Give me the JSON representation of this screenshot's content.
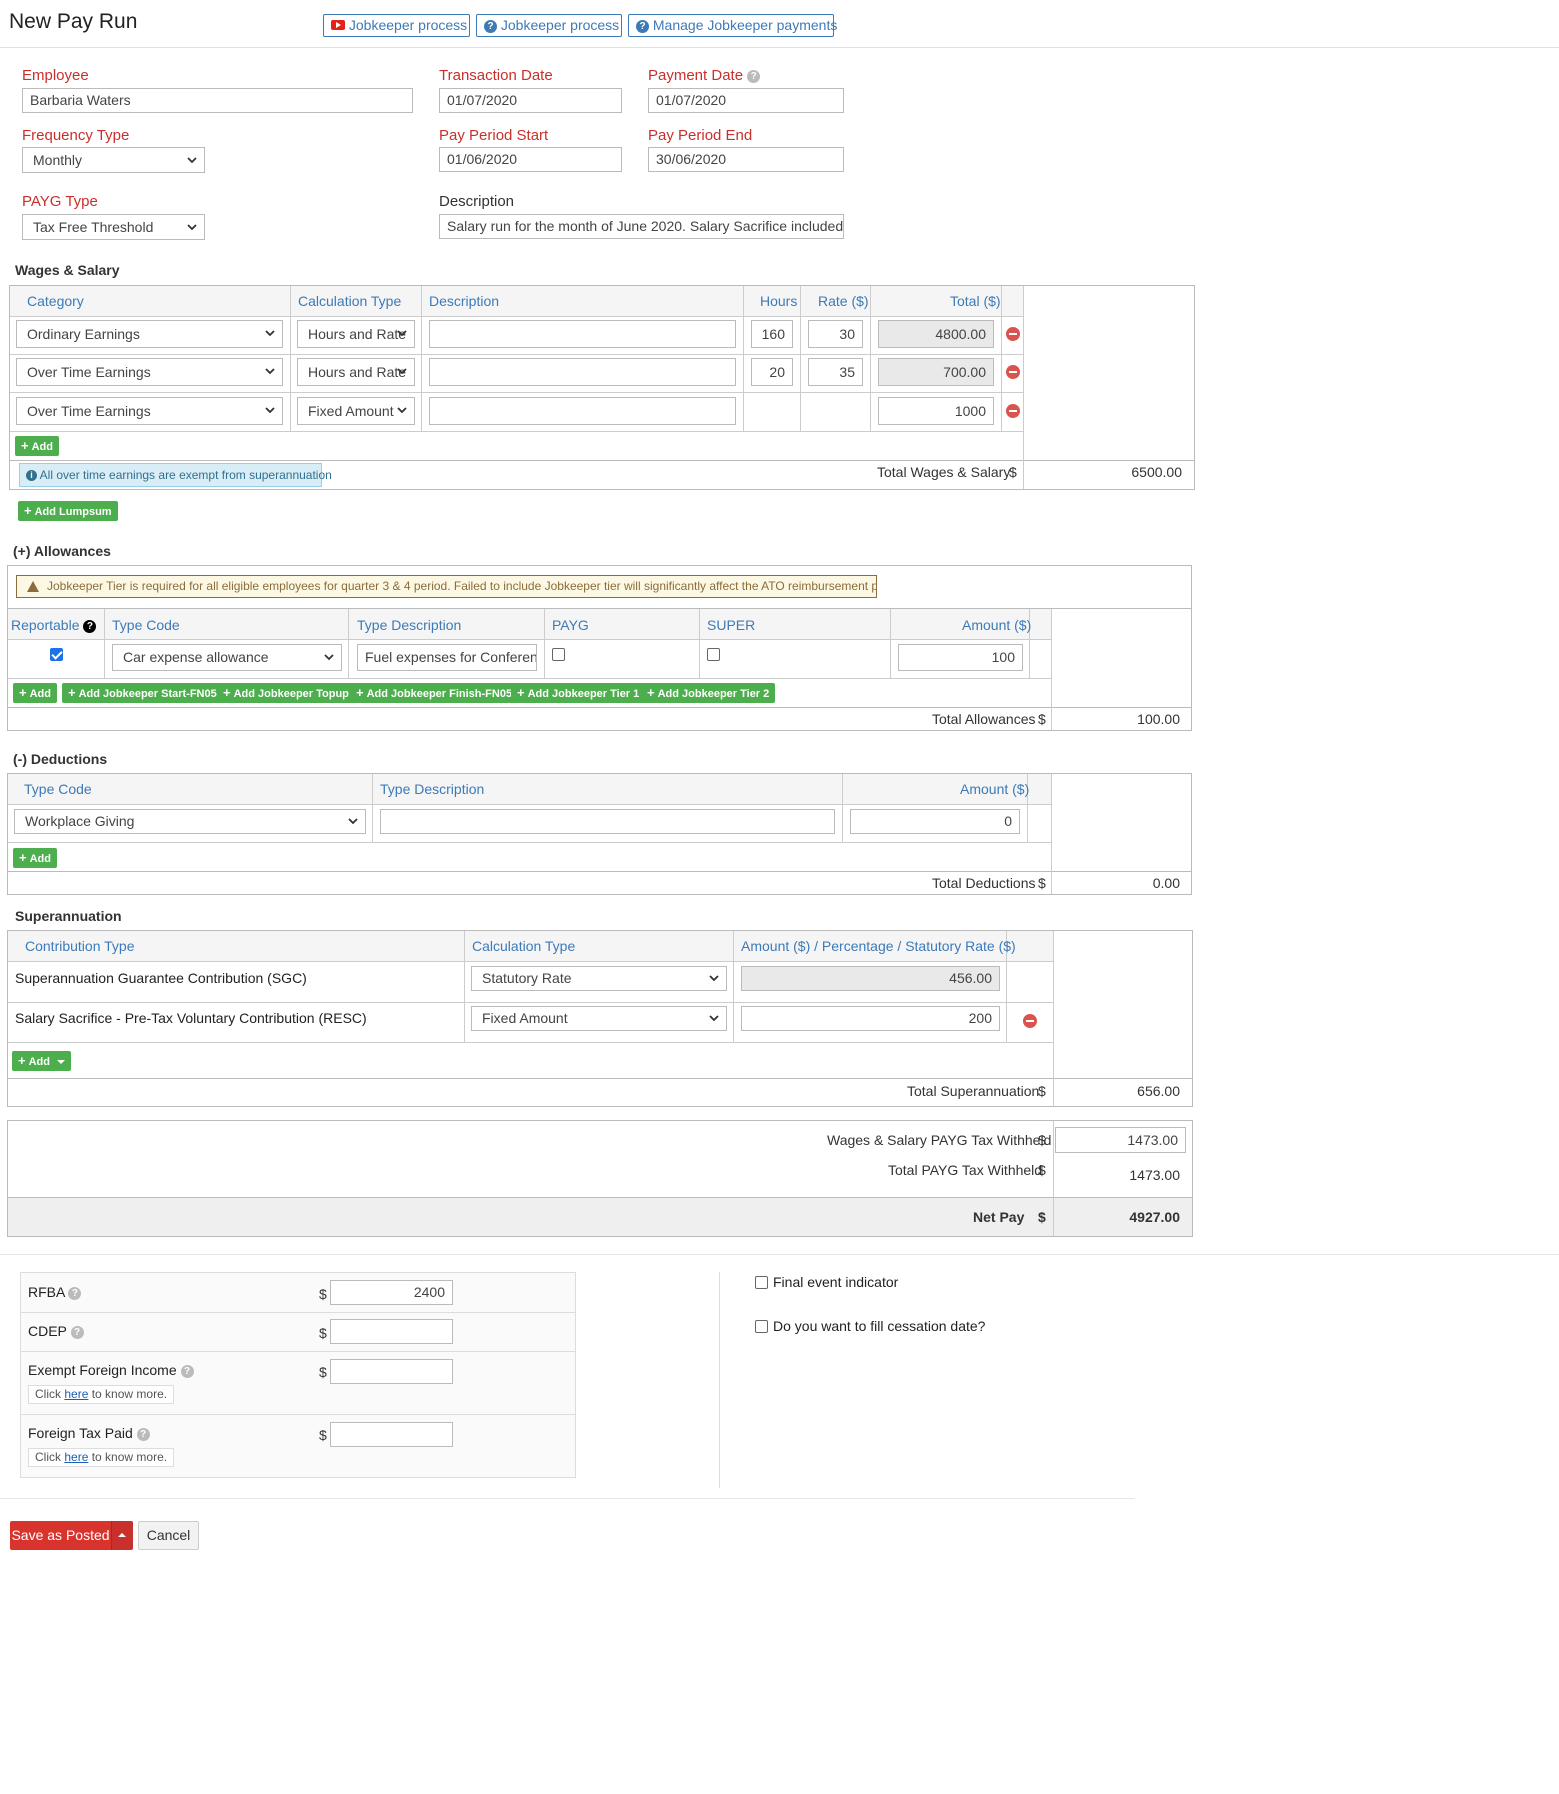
{
  "page_title": "New Pay Run",
  "top_buttons": [
    {
      "label": "Jobkeeper process",
      "icon": "youtube-icon"
    },
    {
      "label": "Jobkeeper process",
      "icon": "question-icon"
    },
    {
      "label": "Manage Jobkeeper payments",
      "icon": "question-icon"
    }
  ],
  "form": {
    "employee_label": "Employee",
    "employee_value": "Barbaria  Waters",
    "transaction_date_label": "Transaction Date",
    "transaction_date": "01/07/2020",
    "payment_date_label": "Payment Date",
    "payment_date": "01/07/2020",
    "frequency_label": "Frequency Type",
    "frequency_value": "Monthly",
    "pay_period_start_label": "Pay Period Start",
    "pay_period_start": "01/06/2020",
    "pay_period_end_label": "Pay Period End",
    "pay_period_end": "30/06/2020",
    "payg_type_label": "PAYG Type",
    "payg_type_value": "Tax Free Threshold",
    "description_label": "Description",
    "description_value": "Salary run for the month of June 2020. Salary Sacrifice included in RFBA"
  },
  "wages": {
    "title": "Wages & Salary",
    "headers": {
      "category": "Category",
      "calc": "Calculation Type",
      "desc": "Description",
      "hours": "Hours",
      "rate": "Rate ($)",
      "total": "Total ($)"
    },
    "rows": [
      {
        "category": "Ordinary Earnings",
        "calc": "Hours and Rate",
        "hours": "160",
        "rate": "30",
        "total": "4800.00"
      },
      {
        "category": "Over Time Earnings",
        "calc": "Hours and Rate",
        "hours": "20",
        "rate": "35",
        "total": "700.00"
      },
      {
        "category": "Over Time Earnings",
        "calc": "Fixed Amount",
        "hours": "",
        "rate": "",
        "total": "1000"
      }
    ],
    "add_label": "Add",
    "info_note": "All over time earnings are exempt from superannuation",
    "total_label": "Total Wages & Salary",
    "currency": "$",
    "total_value": "6500.00",
    "add_lumpsum_label": "Add Lumpsum"
  },
  "allowances": {
    "title": "(+) Allowances",
    "warning": "Jobkeeper Tier is required for all eligible employees for quarter 3 & 4 period. Failed to include Jobkeeper tier will significantly affect the ATO reimbursement process.",
    "headers": {
      "reportable": "Reportable",
      "type_code": "Type Code",
      "type_desc": "Type Description",
      "payg": "PAYG",
      "super": "SUPER",
      "amount": "Amount ($)"
    },
    "row": {
      "reportable": true,
      "type_code": "Car expense allowance",
      "type_desc": "Fuel expenses for Conference",
      "payg": false,
      "super": false,
      "amount": "100"
    },
    "buttons": [
      "Add",
      "Add Jobkeeper Start-FN05",
      "Add Jobkeeper Topup",
      "Add Jobkeeper Finish-FN05",
      "Add Jobkeeper Tier 1",
      "Add Jobkeeper Tier 2"
    ],
    "total_label": "Total Allowances",
    "currency": "$",
    "total_value": "100.00"
  },
  "deductions": {
    "title": "(-) Deductions",
    "headers": {
      "type_code": "Type Code",
      "type_desc": "Type Description",
      "amount": "Amount ($)"
    },
    "row": {
      "type_code": "Workplace Giving",
      "type_desc": "",
      "amount": "0"
    },
    "add_label": "Add",
    "total_label": "Total Deductions",
    "currency": "$",
    "total_value": "0.00"
  },
  "super": {
    "title": "Superannuation",
    "headers": {
      "contribution": "Contribution Type",
      "calc": "Calculation Type",
      "amount": "Amount ($) / Percentage / Statutory Rate ($)"
    },
    "rows": [
      {
        "contribution": "Superannuation Guarantee Contribution (SGC)",
        "calc": "Statutory Rate",
        "amount": "456.00"
      },
      {
        "contribution": "Salary Sacrifice - Pre-Tax Voluntary Contribution (RESC)",
        "calc": "Fixed Amount",
        "amount": "200"
      }
    ],
    "add_label": "Add",
    "total_label": "Total Superannuation",
    "currency": "$",
    "total_value": "656.00"
  },
  "tax": {
    "wages_payg_label": "Wages & Salary PAYG Tax Withheld",
    "wages_payg_value": "1473.00",
    "total_payg_label": "Total PAYG Tax Withheld",
    "total_payg_value": "1473.00",
    "net_pay_label": "Net Pay",
    "net_pay_value": "4927.00",
    "currency": "$"
  },
  "extra": {
    "rfba_label": "RFBA",
    "rfba_value": "2400",
    "cdep_label": "CDEP",
    "cdep_value": "",
    "efi_label": "Exempt Foreign Income",
    "efi_value": "",
    "ftp_label": "Foreign Tax Paid",
    "ftp_value": "",
    "click": "Click",
    "here": "here",
    "know_more": "to know more.",
    "currency": "$"
  },
  "options": {
    "final_event": "Final event indicator",
    "final_event_checked": false,
    "cessation": "Do you want to fill cessation date?",
    "cessation_checked": false
  },
  "footer": {
    "save_label": "Save as Posted",
    "cancel_label": "Cancel"
  }
}
